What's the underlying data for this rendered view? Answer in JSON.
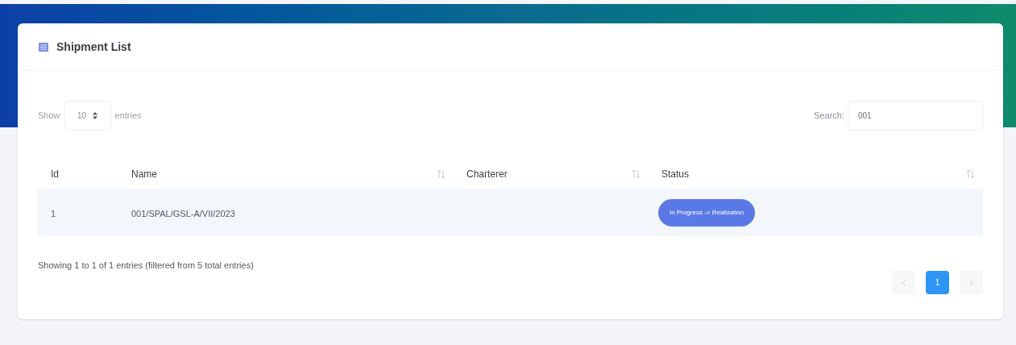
{
  "card": {
    "title": "Shipment List"
  },
  "length": {
    "before": "Show",
    "value": "10",
    "after": "entries"
  },
  "search": {
    "label": "Search:",
    "value": "001"
  },
  "table": {
    "columns": [
      {
        "label": "Id",
        "sortable": false
      },
      {
        "label": "Name",
        "sortable": true
      },
      {
        "label": "Charterer",
        "sortable": true
      },
      {
        "label": "Status",
        "sortable": true
      }
    ],
    "rows": [
      {
        "id": "1",
        "name": "001/SPAL/GSL-A/VII/2023",
        "charterer": "",
        "status": "In Progress -> Realization"
      }
    ]
  },
  "info": "Showing 1 to 1 of 1 entries (filtered from 5 total entries)",
  "pagination": {
    "pages": [
      {
        "label": "1",
        "selected": true
      }
    ]
  }
}
